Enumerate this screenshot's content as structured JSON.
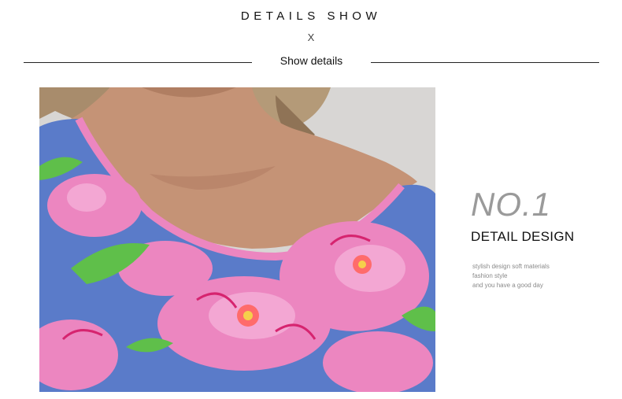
{
  "header": {
    "title": "DETAILS SHOW",
    "x_mark": "X",
    "subtitle": "Show details"
  },
  "feature": {
    "number": "NO.1",
    "title": "DETAIL DESIGN",
    "lines": [
      "stylish design soft materials",
      "fashion style",
      "and you have a good day"
    ]
  },
  "colors": {
    "accent_gray": "#9a9a9a",
    "fabric_pink": "#ec86c0",
    "fabric_blue": "#5a7bc9",
    "fabric_green": "#5fbf4a",
    "skin": "#c59376",
    "hair": "#a88c6c"
  }
}
